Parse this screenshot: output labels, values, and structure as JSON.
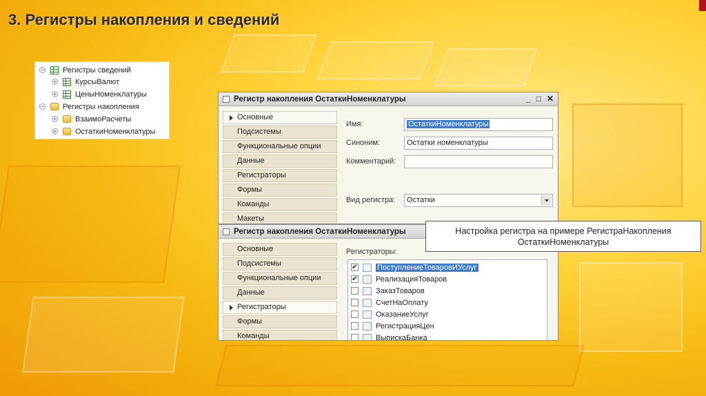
{
  "slide": {
    "title": "3. Регистры накопления и сведений"
  },
  "tree": {
    "items": [
      {
        "label": "Регистры сведений",
        "icon": "grid-icon"
      },
      {
        "label": "КурсыВалют",
        "icon": "grid-icon"
      },
      {
        "label": "ЦеныНоменклатуры",
        "icon": "grid-icon"
      },
      {
        "label": "Регистры накопления",
        "icon": "folder-icon"
      },
      {
        "label": "ВзаимоРасчеты",
        "icon": "folder-icon"
      },
      {
        "label": "ОстаткиНоменклатуры",
        "icon": "folder-icon"
      }
    ]
  },
  "window1": {
    "title": "Регистр накопления ОстаткиНоменклатуры",
    "controls": {
      "minimize": "_",
      "maximize": "□",
      "close": "✕"
    },
    "tabs": [
      "Основные",
      "Подсистемы",
      "Функциональные опции",
      "Данные",
      "Регистраторы",
      "Формы",
      "Команды",
      "Макеты"
    ],
    "active_tab": "Основные",
    "fields": {
      "name_label": "Имя:",
      "name_value": "ОстаткиНоменклатуры",
      "synonym_label": "Синоним:",
      "synonym_value": "Остатки номенклатуры",
      "comment_label": "Комментарий:",
      "comment_value": "",
      "kind_label": "Вид регистра:",
      "kind_value": "Остатки"
    }
  },
  "window2": {
    "title": "Регистр накопления ОстаткиНоменклатуры",
    "tabs": [
      "Основные",
      "Подсистемы",
      "Функциональные опции",
      "Данные",
      "Регистраторы",
      "Формы",
      "Команды"
    ],
    "active_tab": "Регистраторы",
    "registrars_label": "Регистраторы:",
    "registrars": [
      {
        "name": "ПоступлениеТоваровИУслуг",
        "checked": true,
        "selected": true
      },
      {
        "name": "РеализацияТоваров",
        "checked": true,
        "selected": false
      },
      {
        "name": "ЗаказТоваров",
        "checked": false,
        "selected": false
      },
      {
        "name": "СчетНаОплату",
        "checked": false,
        "selected": false
      },
      {
        "name": "ОказаниеУслуг",
        "checked": false,
        "selected": false
      },
      {
        "name": "РегистрацияЦен",
        "checked": false,
        "selected": false
      },
      {
        "name": "ВыпискаБанка",
        "checked": false,
        "selected": false
      }
    ],
    "check_mark": "✔"
  },
  "callout": {
    "text": "Настройка регистра на примере РегистраНакопления ОстаткиНоменклатуры"
  },
  "colors": {
    "accent_red": "#b1121a",
    "selection_blue": "#3d7ccf",
    "background_yellow": "#ffd33a"
  }
}
